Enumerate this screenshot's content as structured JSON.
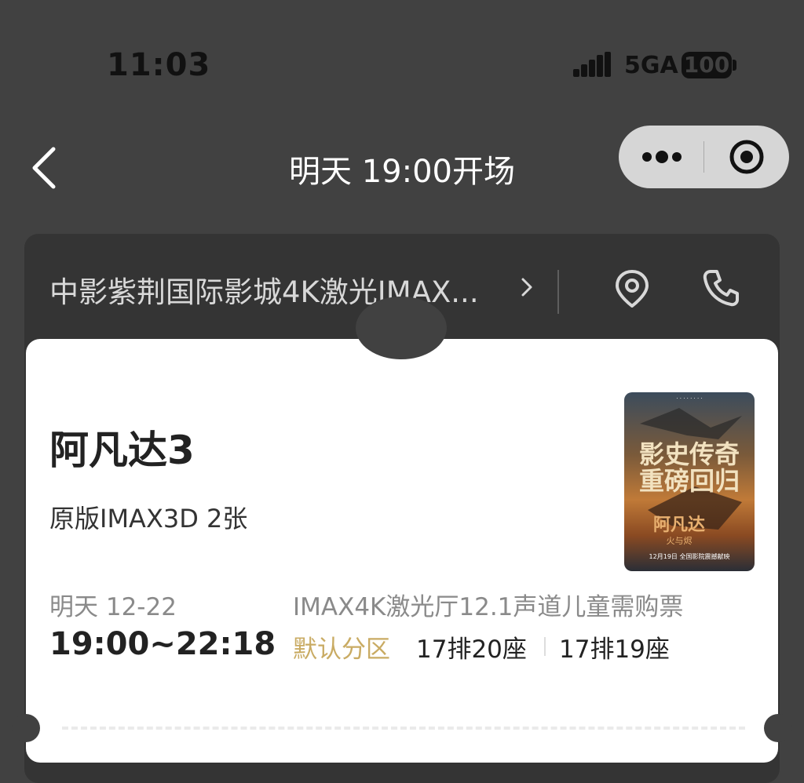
{
  "status_bar": {
    "time": "11:03",
    "network": "5GA",
    "battery": "100"
  },
  "nav": {
    "title": "明天 19:00开场"
  },
  "cinema": {
    "name": "中影紫荆国际影城4K激光IMAX...",
    "icons": [
      "chevron-right-icon",
      "location-icon",
      "phone-icon"
    ]
  },
  "ticket": {
    "movie_title": "阿凡达3",
    "format": "原版IMAX3D 2张",
    "date": "明天 12-22",
    "time_range": "19:00~22:18",
    "hall": "IMAX4K激光厅12.1声道儿童需购票",
    "zone": "默认分区",
    "seats": [
      "17排20座",
      "17排19座"
    ],
    "poster": {
      "headline": "影史传奇重磅回归",
      "title": "阿凡达",
      "subtitle": "火与烬",
      "date_line": "12月19日 全国影院震撼献映"
    }
  },
  "colors": {
    "background": "#414141",
    "card": "#343434",
    "accent_gold": "#c9ab63"
  }
}
